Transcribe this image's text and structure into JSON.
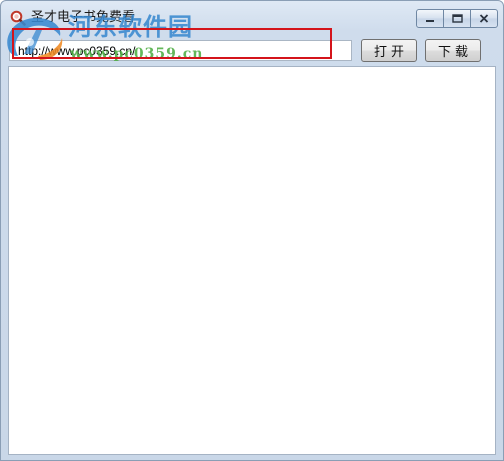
{
  "window": {
    "title": "圣才电子书免费看"
  },
  "caption": {
    "minimize": "minimize-icon",
    "maximize": "maximize-icon",
    "close": "close-icon"
  },
  "toolbar": {
    "url_value": "http://www.pc0359.cn/",
    "open_label": "打开",
    "download_label": "下载"
  },
  "watermark": {
    "cn_text": "河东软件园",
    "url_text": "www.pc0359.cn"
  },
  "colors": {
    "highlight": "#d4141b",
    "watermark_blue": "#3a8ad0",
    "watermark_green": "#4fae44"
  }
}
